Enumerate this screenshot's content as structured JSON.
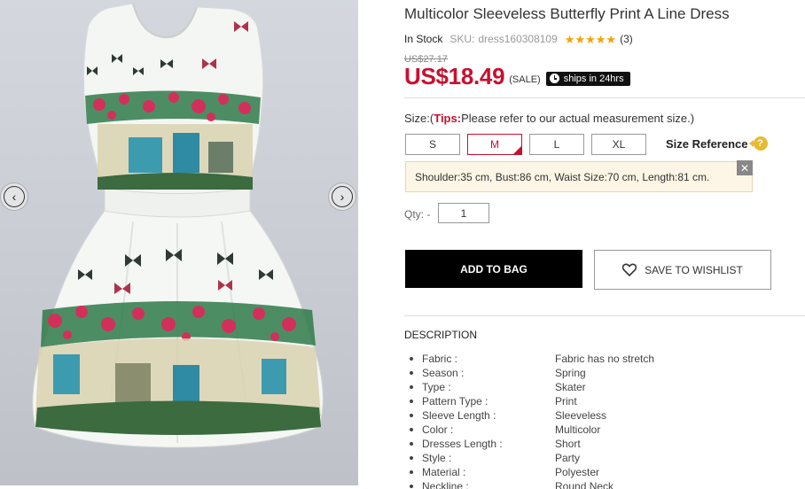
{
  "product": {
    "title": "Multicolor Sleeveless Butterfly Print A Line Dress",
    "stock": "In Stock",
    "sku_label": "SKU:",
    "sku": "dress160308109",
    "rating": 5,
    "reviews": "(3)",
    "old_price": "US$27.17",
    "price": "US$18.49",
    "sale_label": "(SALE)",
    "shipping_badge": "ships in 24hrs"
  },
  "size": {
    "label_prefix": "Size:(",
    "tips_label": "Tips:",
    "tips_text": "Please refer to our actual measurement size.)",
    "options": [
      "S",
      "M",
      "L",
      "XL"
    ],
    "selected": "M",
    "reference_label": "Size Reference",
    "reference_icon": "?",
    "measurement": "Shoulder:35 cm, Bust:86 cm, Waist Size:70 cm, Length:81 cm.",
    "close_symbol": "✕"
  },
  "quantity": {
    "label": "Qty: -",
    "value": "1"
  },
  "actions": {
    "add_to_bag": "ADD TO BAG",
    "wishlist": "SAVE TO WISHLIST"
  },
  "gallery": {
    "prev_symbol": "‹",
    "next_symbol": "›"
  },
  "description": {
    "title": "DESCRIPTION",
    "specs": [
      {
        "key": "Fabric :",
        "value": "Fabric has no stretch"
      },
      {
        "key": "Season :",
        "value": "Spring"
      },
      {
        "key": "Type :",
        "value": "Skater"
      },
      {
        "key": "Pattern Type :",
        "value": "Print"
      },
      {
        "key": "Sleeve Length :",
        "value": "Sleeveless"
      },
      {
        "key": "Color :",
        "value": "Multicolor"
      },
      {
        "key": "Dresses Length :",
        "value": "Short"
      },
      {
        "key": "Style :",
        "value": "Party"
      },
      {
        "key": "Material :",
        "value": "Polyester"
      },
      {
        "key": "Neckline :",
        "value": "Round Neck"
      }
    ]
  },
  "colors": {
    "price_red": "#c8102e",
    "button_black": "#000000",
    "star_gold": "#f5a200",
    "tip_box_bg": "#fdf6e6"
  }
}
